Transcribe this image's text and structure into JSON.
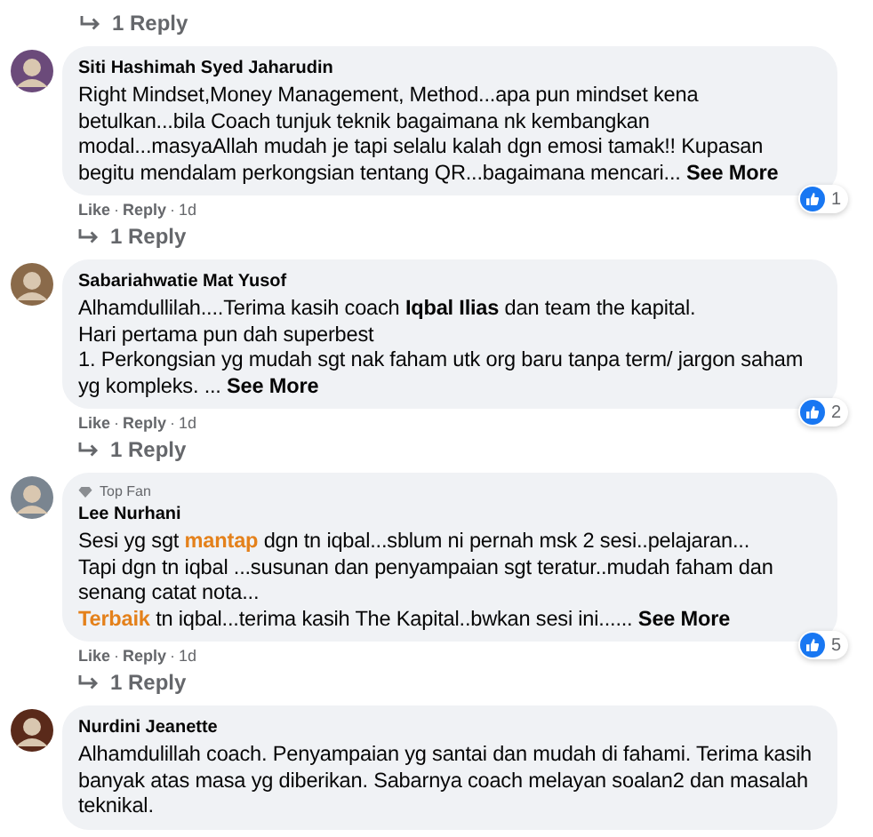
{
  "top_reply_link": "1 Reply",
  "comments": [
    {
      "name": "Siti Hashimah Syed Jaharudin",
      "body": [
        [
          {
            "t": "Right Mindset,Money Management, Method...apa pun mindset kena betulkan...bila Coach tunjuk teknik bagaimana nk kembangkan modal...masyaAllah mudah je tapi selalu kalah dgn emosi tamak!! Kupasan begitu mendalam perkongsian tentang QR...bagaimana mencari... "
          }
        ]
      ],
      "see_more": "See More",
      "reactions": "1",
      "actions": [
        "Like",
        "Reply"
      ],
      "separator": "·",
      "time": "1d",
      "replies": "1 Reply"
    },
    {
      "name": "Sabariahwatie Mat Yusof",
      "body": [
        [
          {
            "t": "Alhamdullilah....Terima kasih coach "
          },
          {
            "t": "Iqbal Ilias",
            "kind": "mention"
          },
          {
            "t": " dan team the kapital."
          }
        ],
        [
          {
            "t": "Hari pertama pun dah superbest"
          }
        ],
        [
          {
            "t": "1. Perkongsian yg mudah sgt nak faham utk org baru tanpa term/ jargon saham yg kompleks. ... "
          }
        ]
      ],
      "see_more": "See More",
      "reactions": "2",
      "actions": [
        "Like",
        "Reply"
      ],
      "separator": "·",
      "time": "1d",
      "replies": "1 Reply"
    },
    {
      "badge": "Top Fan",
      "name": "Lee Nurhani",
      "body": [
        [
          {
            "t": "Sesi yg sgt "
          },
          {
            "t": "mantap",
            "kind": "highlight"
          },
          {
            "t": " dgn tn iqbal...sblum ni pernah msk 2 sesi..pelajaran..."
          }
        ],
        [
          {
            "t": "Tapi dgn tn iqbal ...susunan dan penyampaian sgt teratur..mudah faham dan senang catat nota..."
          }
        ],
        [
          {
            "t": "Terbaik",
            "kind": "highlight"
          },
          {
            "t": " tn iqbal...terima kasih The Kapital..bwkan sesi ini...... "
          }
        ]
      ],
      "see_more": "See More",
      "reactions": "5",
      "actions": [
        "Like",
        "Reply"
      ],
      "separator": "·",
      "time": "1d",
      "replies": "1 Reply"
    },
    {
      "name": "Nurdini Jeanette",
      "body": [
        [
          {
            "t": "Alhamdulillah coach. Penyampaian yg santai dan mudah di fahami. Terima kasih banyak atas masa yg diberikan. Sabarnya coach melayan soalan2 dan masalah teknikal."
          }
        ]
      ]
    }
  ]
}
